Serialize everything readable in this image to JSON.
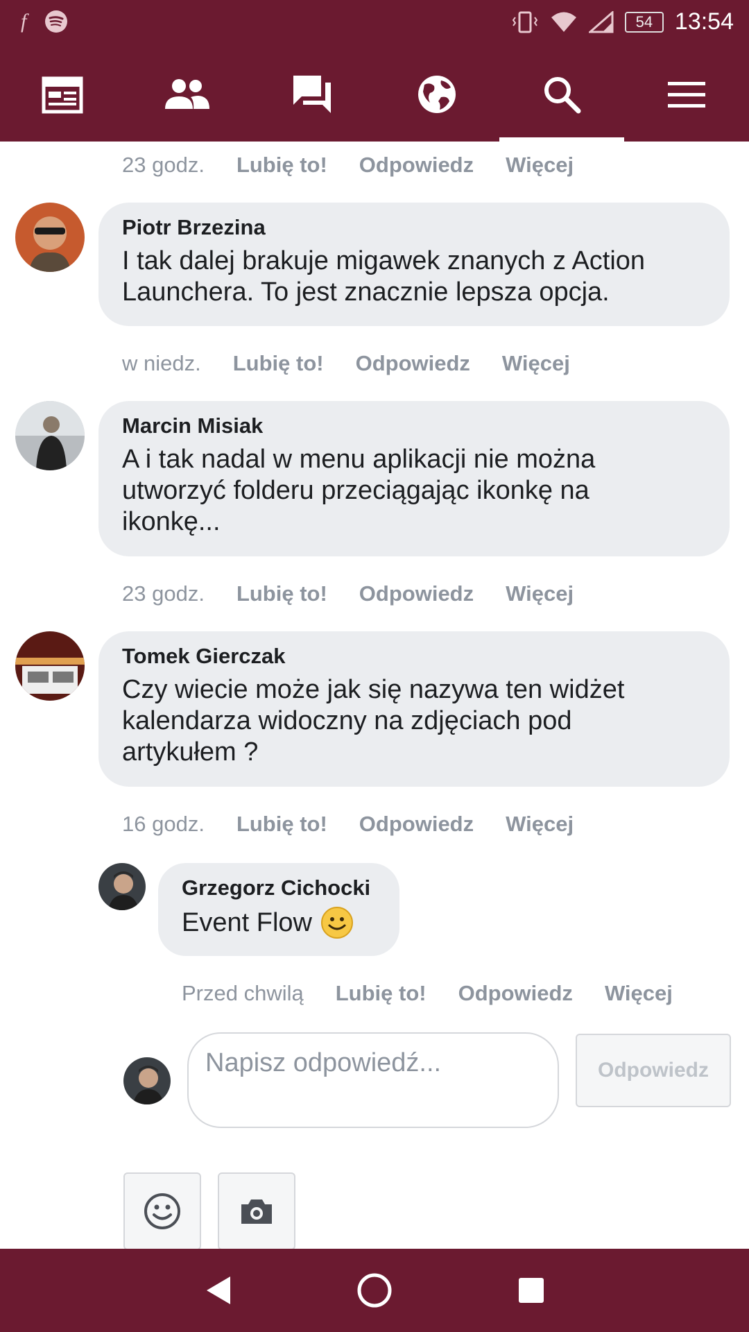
{
  "status_bar": {
    "time": "13:54",
    "battery": "54",
    "icons": [
      "facebook-icon",
      "spotify-icon",
      "vibrate-icon",
      "wifi-icon",
      "signal-icon"
    ]
  },
  "nav_tabs": [
    {
      "name": "news-feed",
      "icon": "news-feed-icon",
      "active": false
    },
    {
      "name": "friends",
      "icon": "friends-icon",
      "active": false
    },
    {
      "name": "messages",
      "icon": "messages-icon",
      "active": false
    },
    {
      "name": "notifications",
      "icon": "globe-icon",
      "active": false
    },
    {
      "name": "search",
      "icon": "search-icon",
      "active": true
    },
    {
      "name": "menu",
      "icon": "menu-icon",
      "active": false
    }
  ],
  "actions": {
    "like": "Lubię to!",
    "reply": "Odpowiedz",
    "more": "Więcej"
  },
  "top_meta": {
    "time": "23 godz."
  },
  "comments": [
    {
      "author": "Piotr Brzezina",
      "text_lines": [
        "I tak dalej brakuje migawek znanych z Action",
        "Launchera. To jest znacznie lepsza opcja."
      ],
      "time": "w niedz."
    },
    {
      "author": "Marcin Misiak",
      "text_lines": [
        "A i tak nadal w menu aplikacji nie można",
        "utworzyć folderu przeciągając ikonkę na",
        "ikonkę..."
      ],
      "time": "23 godz."
    },
    {
      "author": "Tomek Gierczak",
      "text_lines": [
        "Czy wiecie może jak się nazywa ten widżet",
        "kalendarza widoczny na zdjęciach pod",
        "artykułem ?"
      ],
      "time": "16 godz."
    }
  ],
  "reply": {
    "author": "Grzegorz Cichocki",
    "text": "Event Flow",
    "emoji": "🙂",
    "time": "Przed chwilą"
  },
  "composer": {
    "placeholder": "Napisz odpowiedź...",
    "submit_label": "Odpowiedz"
  },
  "colors": {
    "brand": "#6b1a30",
    "bubble": "#ebedf0",
    "muted": "#8d949e"
  }
}
